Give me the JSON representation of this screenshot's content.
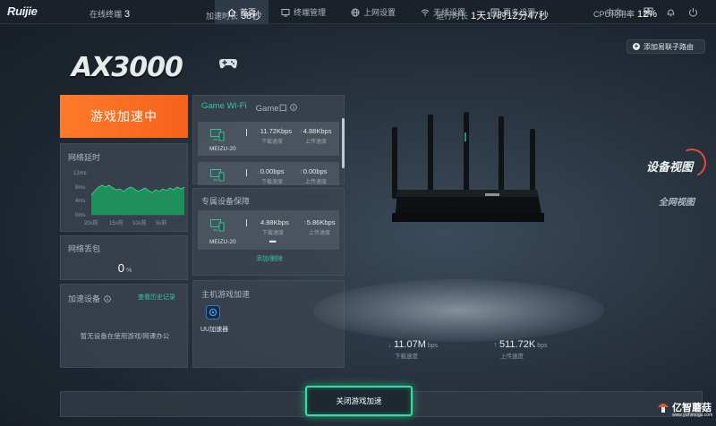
{
  "header": {
    "logo": "Ruijie",
    "nav": [
      {
        "label": "首页",
        "icon": "home-icon",
        "active": true
      },
      {
        "label": "终端管理",
        "icon": "terminal-icon",
        "active": false
      },
      {
        "label": "上网设置",
        "icon": "globe-icon",
        "active": false
      },
      {
        "label": "无线设置",
        "icon": "wifi-icon",
        "active": false
      },
      {
        "label": "更多设置",
        "icon": "sliders-icon",
        "active": false
      }
    ],
    "language": "中文",
    "language_chevron": "⌄"
  },
  "add_mesh_label": "添加易联子路由",
  "brand_model": "AX3000",
  "accelerate_status": "游戏加速中",
  "latency": {
    "title": "网络延时",
    "y_ticks": [
      "12ms",
      "8ms",
      "4ms",
      "0ms"
    ],
    "x_ticks": [
      "20s前",
      "15s前",
      "10s前",
      "5s前"
    ]
  },
  "packet_loss": {
    "title": "网络丢包",
    "value": "0",
    "unit": "%"
  },
  "accel_devices": {
    "title": "加速设备",
    "history_link": "查看历史记录",
    "empty_text": "暂无设备在使用游戏/网课办公"
  },
  "game_wifi": {
    "tabs": [
      "Game Wi-Fi",
      "Game口"
    ],
    "devices": [
      {
        "name": "MEIZU-20",
        "down": "11.72Kbps",
        "up": "4.88Kbps",
        "down_label": "下载速度",
        "up_label": "上传速度"
      },
      {
        "name": "",
        "down": "0.00bps",
        "up": "0.00bps",
        "down_label": "下载速度",
        "up_label": "上传速度"
      }
    ]
  },
  "special_guarantee": {
    "title": "专属设备保障",
    "device": {
      "name": "MEIZU-20",
      "down": "4.88Kbps",
      "up": "5.86Kbps",
      "down_label": "下载速度",
      "up_label": "上传速度",
      "extra": "▬"
    },
    "add_remove": "添加/删除"
  },
  "host_accel": {
    "title": "主机游戏加速",
    "app": "UU加速器"
  },
  "views": {
    "device": "设备视图",
    "network": "全网视图"
  },
  "wan": {
    "down": {
      "value": "11.07M",
      "unit": "bps",
      "label": "下载速度"
    },
    "up": {
      "value": "511.72K",
      "unit": "bps",
      "label": "上传速度"
    }
  },
  "bottom": {
    "online_label": "在线终端",
    "online_value": "3",
    "accel_time_label": "加速时长",
    "accel_time_value": "38秒",
    "stop_button": "关闭游戏加速",
    "uptime_label": "运行时长",
    "uptime_value": "1天17时12分47秒",
    "cpu_label": "CPU利用率",
    "cpu_value": "12%"
  },
  "watermark": {
    "text": "亿智蘑菇",
    "site": "www.yizhimogu.com"
  },
  "colors": {
    "accent": "#36c8a4",
    "orange": "#f5621b",
    "down_arrow": "#2e8cf0",
    "up_arrow": "#2ec58a",
    "ring": "#e64a3a"
  }
}
